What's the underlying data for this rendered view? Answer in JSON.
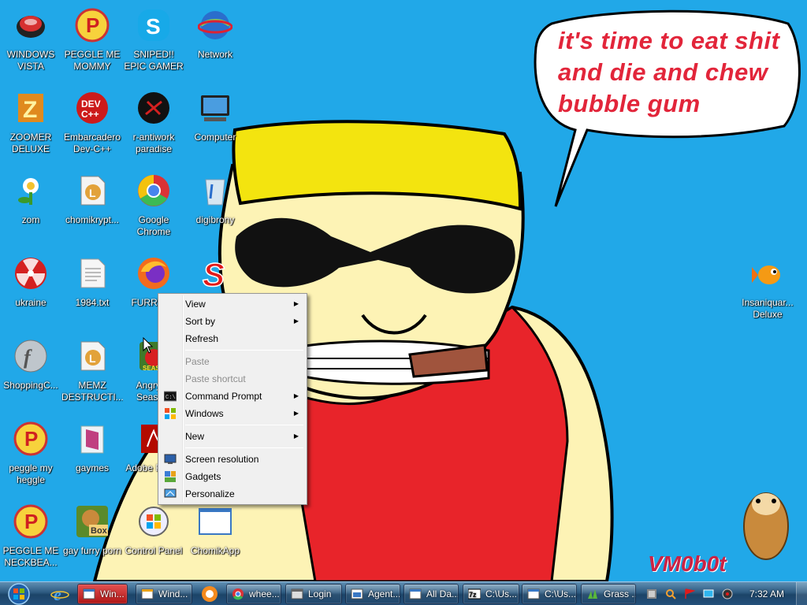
{
  "wallpaper": {
    "speech_text": "it's time to eat shit and die and chew bubble gum",
    "signature": "VM0b0t"
  },
  "desktop_icons": [
    {
      "label": "WINDOWS VISTA",
      "icon": "windows-vista-icon"
    },
    {
      "label": "PEGGLE ME MOMMY",
      "icon": "peggle-icon"
    },
    {
      "label": "SNIPED!! EPIC GAMER 360...",
      "icon": "skype-icon"
    },
    {
      "label": "Network",
      "icon": "network-globe-icon"
    },
    {
      "label": "ZOOMER DELUXE",
      "icon": "zoomer-deluxe-icon"
    },
    {
      "label": "Embarcadero Dev-C++",
      "icon": "dev-cpp-icon"
    },
    {
      "label": "r-antiwork paradise",
      "icon": "antiwork-icon"
    },
    {
      "label": "Computer",
      "icon": "computer-icon"
    },
    {
      "label": "zom",
      "icon": "flower-zombie-icon"
    },
    {
      "label": "chomikrypt...",
      "icon": "chomik-file-icon"
    },
    {
      "label": "Google Chrome",
      "icon": "chrome-icon"
    },
    {
      "label": "digibrony",
      "icon": "recycle-bin-icon"
    },
    {
      "label": "ukraine",
      "icon": "radiation-icon"
    },
    {
      "label": "1984.txt",
      "icon": "text-file-icon"
    },
    {
      "label": "FURRYF...",
      "icon": "firefox-icon"
    },
    {
      "label": "",
      "icon": "red-s-icon"
    },
    {
      "label": "ShoppingC...",
      "icon": "flash-icon"
    },
    {
      "label": "MEMZ DESTRUCTI...",
      "icon": "chomik-file-icon"
    },
    {
      "label": "Angry ... Seaso...",
      "icon": "angry-birds-icon"
    },
    {
      "label": "peggle my heggle",
      "icon": "peggle-icon"
    },
    {
      "label": "gaymes",
      "icon": "folder-icon"
    },
    {
      "label": "Adobe R... XI",
      "icon": "adobe-reader-icon"
    },
    {
      "label": "PEGGLE ME NECKBEA...",
      "icon": "peggle-icon"
    },
    {
      "label": "gay furry porn",
      "icon": "box-hamster-icon"
    },
    {
      "label": "Control Panel",
      "icon": "control-panel-icon"
    },
    {
      "label": "ChomikApp",
      "icon": "blank-app-icon"
    },
    {
      "label": "Insaniquar... Deluxe",
      "icon": "goldfish-icon"
    }
  ],
  "context_menu": {
    "items": [
      {
        "label": "View",
        "submenu": true,
        "disabled": false,
        "icon": ""
      },
      {
        "label": "Sort by",
        "submenu": true,
        "disabled": false,
        "icon": ""
      },
      {
        "label": "Refresh",
        "submenu": false,
        "disabled": false,
        "icon": ""
      },
      {
        "label": "Paste",
        "submenu": false,
        "disabled": true,
        "icon": ""
      },
      {
        "label": "Paste shortcut",
        "submenu": false,
        "disabled": true,
        "icon": ""
      },
      {
        "label": "Command Prompt",
        "submenu": true,
        "disabled": false,
        "icon": "cmd-icon"
      },
      {
        "label": "Windows",
        "submenu": true,
        "disabled": false,
        "icon": "windows-flag-icon"
      },
      {
        "label": "New",
        "submenu": true,
        "disabled": false,
        "icon": ""
      },
      {
        "label": "Screen resolution",
        "submenu": false,
        "disabled": false,
        "icon": "monitor-icon"
      },
      {
        "label": "Gadgets",
        "submenu": false,
        "disabled": false,
        "icon": "gadgets-icon"
      },
      {
        "label": "Personalize",
        "submenu": false,
        "disabled": false,
        "icon": "personalize-icon"
      }
    ]
  },
  "taskbar": {
    "buttons": [
      {
        "label": "Win...",
        "icon": "windows-app-icon"
      },
      {
        "label": "Wind...",
        "icon": "window-icon"
      },
      {
        "label": "whee...",
        "icon": "chrome-icon"
      },
      {
        "label": "Login",
        "icon": "login-icon"
      },
      {
        "label": "Agent...",
        "icon": "agent-icon"
      },
      {
        "label": "All Da...",
        "icon": "window-icon"
      },
      {
        "label": "C:\\Us...",
        "icon": "7zip-icon"
      },
      {
        "label": "C:\\Us...",
        "icon": "window-icon"
      },
      {
        "label": "Grass ...",
        "icon": "grass-icon"
      }
    ],
    "clock": "7:32 AM",
    "accent": "#2d5a80"
  }
}
